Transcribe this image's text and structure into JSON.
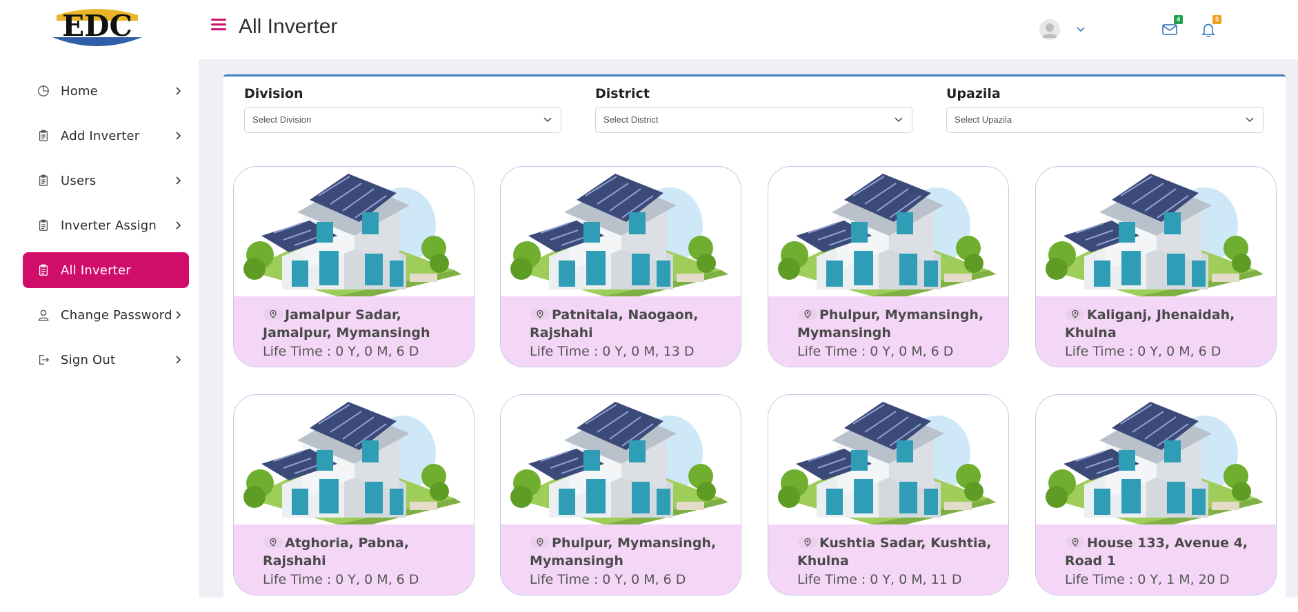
{
  "app": {
    "logo_text": "EDC"
  },
  "sidebar": {
    "items": [
      {
        "label": "Home",
        "icon": "pie-chart-icon",
        "active": false
      },
      {
        "label": "Add Inverter",
        "icon": "clipboard-icon",
        "active": false
      },
      {
        "label": "Users",
        "icon": "clipboard-icon",
        "active": false
      },
      {
        "label": "Inverter Assign",
        "icon": "clipboard-icon",
        "active": false
      },
      {
        "label": "All Inverter",
        "icon": "clipboard-icon",
        "active": true
      },
      {
        "label": "Change Password",
        "icon": "user-icon",
        "active": false
      },
      {
        "label": "Sign Out",
        "icon": "sign-out-icon",
        "active": false
      }
    ]
  },
  "header": {
    "title": "All Inverter",
    "mail_count": "4",
    "notification_count": "5"
  },
  "filters": {
    "division": {
      "label": "Division",
      "value": "Select Division"
    },
    "district": {
      "label": "District",
      "value": "Select District"
    },
    "upazila": {
      "label": "Upazila",
      "value": "Select Upazila"
    }
  },
  "inverters": [
    {
      "location": "Jamalpur Sadar, Jamalpur, Mymansingh",
      "lifetime": "Life Time : 0 Y, 0 M, 6 D"
    },
    {
      "location": "Patnitala, Naogaon, Rajshahi",
      "lifetime": "Life Time : 0 Y, 0 M, 13 D"
    },
    {
      "location": "Phulpur, Mymansingh, Mymansingh",
      "lifetime": "Life Time : 0 Y, 0 M, 6 D"
    },
    {
      "location": "Kaliganj, Jhenaidah, Khulna",
      "lifetime": "Life Time : 0 Y, 0 M, 6 D"
    },
    {
      "location": "Atghoria, Pabna, Rajshahi",
      "lifetime": "Life Time : 0 Y, 0 M, 6 D"
    },
    {
      "location": "Phulpur, Mymansingh, Mymansingh",
      "lifetime": "Life Time : 0 Y, 0 M, 6 D"
    },
    {
      "location": "Kushtia Sadar, Kushtia, Khulna",
      "lifetime": "Life Time : 0 Y, 0 M, 11 D"
    },
    {
      "location": "House 133, Avenue 4, Road 1",
      "lifetime": "Life Time : 0 Y, 1 M, 20 D"
    }
  ],
  "colors": {
    "accent": "#d10d6a",
    "card_footer": "#f4d7f6",
    "panel_border": "#3e7fbf",
    "mail_badge": "#1fa34a",
    "bell_badge": "#f0a020"
  }
}
